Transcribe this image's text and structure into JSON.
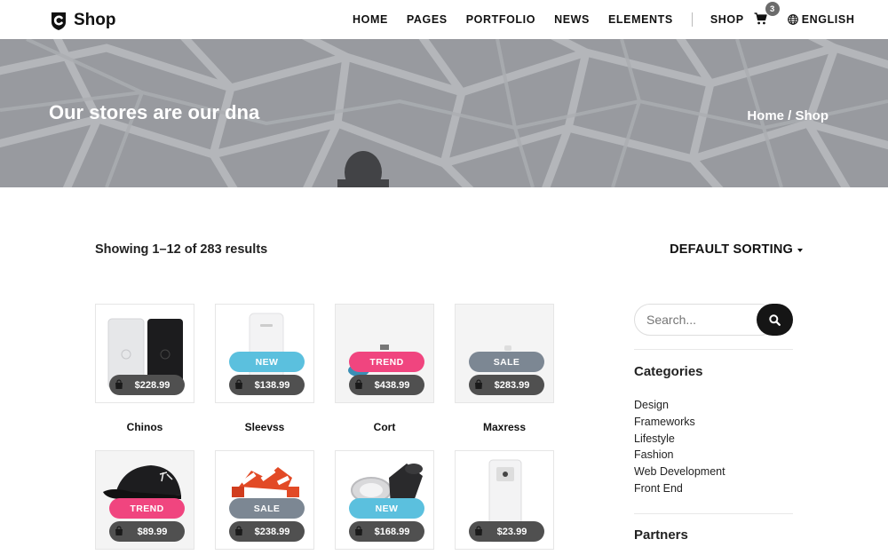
{
  "header": {
    "logo_text": "Shop",
    "nav": [
      "HOME",
      "PAGES",
      "PORTFOLIO",
      "NEWS",
      "ELEMENTS"
    ],
    "shop_label": "SHOP",
    "cart_count": "3",
    "language": "ENGLISH"
  },
  "hero": {
    "title": "Our stores are our dna",
    "breadcrumb": "Home / Shop"
  },
  "toolbar": {
    "result_count": "Showing 1–12 of 283 results",
    "sorting": "DEFAULT SORTING"
  },
  "products": [
    {
      "name": "Chinos",
      "price": "$228.99",
      "tag": ""
    },
    {
      "name": "Sleevss",
      "price": "$138.99",
      "tag": "NEW"
    },
    {
      "name": "Cort",
      "price": "$438.99",
      "tag": "TREND"
    },
    {
      "name": "Maxress",
      "price": "$283.99",
      "tag": "SALE"
    },
    {
      "name": "",
      "price": "$89.99",
      "tag": "TREND"
    },
    {
      "name": "",
      "price": "$238.99",
      "tag": "SALE"
    },
    {
      "name": "",
      "price": "$168.99",
      "tag": "NEW"
    },
    {
      "name": "",
      "price": "$23.99",
      "tag": ""
    }
  ],
  "tag_colors": {
    "NEW": "#5bc0de",
    "TREND": "#f0457f",
    "SALE": "#7c8793"
  },
  "sidebar": {
    "search_placeholder": "Search...",
    "categories_title": "Categories",
    "categories": [
      "Design",
      "Frameworks",
      "Lifestyle",
      "Fashion",
      "Web Development",
      "Front End"
    ],
    "partners_title": "Partners"
  }
}
